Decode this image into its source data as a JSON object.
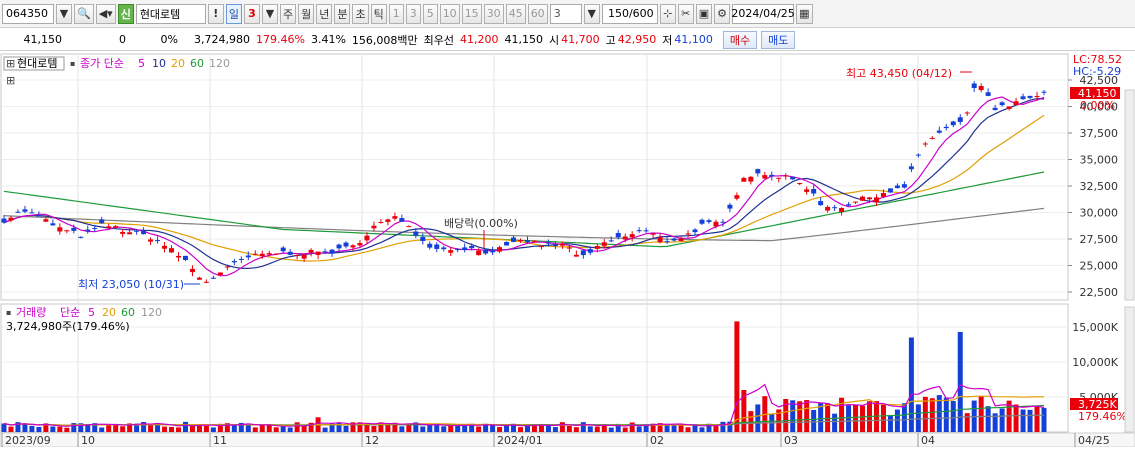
{
  "toolbar": {
    "code": "064350",
    "sin_label": "신",
    "stock_name": "현대로템",
    "exclaim": "!",
    "period_day": "일",
    "period_num": "3",
    "periods": [
      "주",
      "월",
      "년",
      "분",
      "초",
      "틱"
    ],
    "ticks": [
      "1",
      "3",
      "5",
      "10",
      "15",
      "30",
      "45",
      "60"
    ],
    "tick_select": "3",
    "count": "150/600",
    "date": "2024/04/25"
  },
  "quote": {
    "price": "41,150",
    "change": "0",
    "change_pct": "0%",
    "volume": "3,724,980",
    "volume_ratio": "179.46%",
    "turnover": "3.41%",
    "amount": "156,008백만",
    "best_bid_label": "최우선",
    "best_bid": "41,200",
    "best_ask": "41,150",
    "open_label": "시",
    "open": "41,700",
    "high_label": "고",
    "high": "42,950",
    "low_label": "저",
    "low": "41,100",
    "buy_label": "매수",
    "sell_label": "매도"
  },
  "price_pane": {
    "stock_label": "현대로템",
    "ma_label": "종가 단순",
    "ma_periods": [
      "5",
      "10",
      "20",
      "60",
      "120"
    ],
    "lc": "LC:78.52",
    "hc": "HC:-5.29",
    "current": "41,150",
    "current_pct": "0.00%",
    "high_note": "최고 43,450 (04/12)",
    "low_note": "최저 23,050 (10/31)",
    "dividend_note": "배당락(0.00%)",
    "y_ticks": [
      "42,500",
      "40,000",
      "37,500",
      "35,000",
      "32,500",
      "30,000",
      "27,500",
      "25,000",
      "22,500"
    ],
    "y_values": [
      42500,
      40000,
      37500,
      35000,
      32500,
      30000,
      27500,
      25000,
      22500
    ]
  },
  "volume_pane": {
    "label": "거래량",
    "ma_label": "단순",
    "ma_periods": [
      "5",
      "20",
      "60",
      "120"
    ],
    "volume_text": "3,724,980주(179.46%)",
    "y_ticks": [
      "15,000K",
      "10,000K",
      "5,000K"
    ],
    "y_values": [
      15000,
      10000,
      5000
    ],
    "current": "3,725K",
    "current_pct": "179.46%"
  },
  "x_axis": [
    "2023/09",
    "10",
    "11",
    "12",
    "2024/01",
    "02",
    "03",
    "04",
    "04/25"
  ],
  "colors": {
    "up": "#e8000b",
    "down": "#1440d8",
    "ma5": "#cc00cc",
    "ma10": "#1f2f90",
    "ma20": "#e0a000",
    "ma60": "#1f9a3a",
    "ma120": "#808080"
  }
}
